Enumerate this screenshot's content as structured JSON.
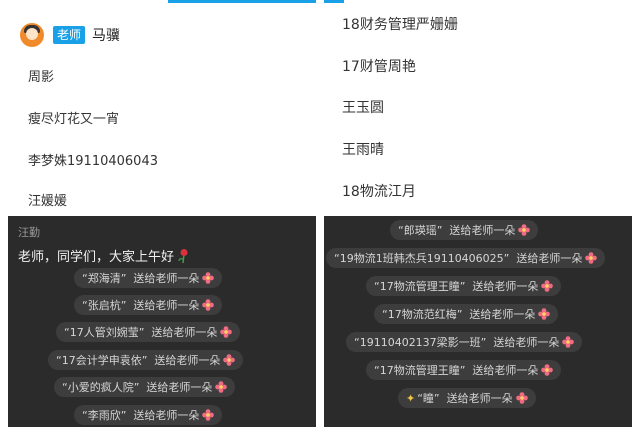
{
  "top_left": {
    "teacher": {
      "badge": "老师",
      "name": "马骥"
    },
    "members": [
      "周影",
      "瘦尽灯花又一宵",
      "李梦姝19110406043",
      "汪媛媛"
    ]
  },
  "top_right": {
    "members": [
      "18财务管理严姗姗",
      "17财管周艳",
      "王玉圆",
      "王雨晴",
      "18物流江月"
    ]
  },
  "chat_left": {
    "sender": "汪勤",
    "message": "老师，同学们，大家上午好",
    "gifts": [
      {
        "who": "“郑海清”",
        "action": "送给老师一朵"
      },
      {
        "who": "“张启杭”",
        "action": "送给老师一朵"
      },
      {
        "who": "“17人管刘婉莹”",
        "action": "送给老师一朵"
      },
      {
        "who": "“17会计学申袁依”",
        "action": "送给老师一朵"
      },
      {
        "who": "“小爱的疯人院”",
        "action": "送给老师一朵"
      },
      {
        "who": "“李雨欣”",
        "action": "送给老师一朵"
      }
    ]
  },
  "chat_right": {
    "gifts": [
      {
        "who": "“郎瑛瑶”",
        "action": "送给老师一朵"
      },
      {
        "who": "“19物流1班韩杰兵19110406025”",
        "action": "送给老师一朵"
      },
      {
        "who": "“17物流管理王瞳”",
        "action": "送给老师一朵"
      },
      {
        "who": "“17物流范红梅”",
        "action": "送给老师一朵"
      },
      {
        "who": "“19110402137梁影一班”",
        "action": "送给老师一朵"
      },
      {
        "who": "“17物流管理王瞳”",
        "action": "送给老师一朵"
      },
      {
        "who": "“瞳”",
        "action": "送给老师一朵"
      }
    ]
  },
  "colors": {
    "accent": "#1aa0e6",
    "chat_bg": "#2b2b2b",
    "pill_bg": "#3d3d3d",
    "flower": "#f06b83"
  }
}
